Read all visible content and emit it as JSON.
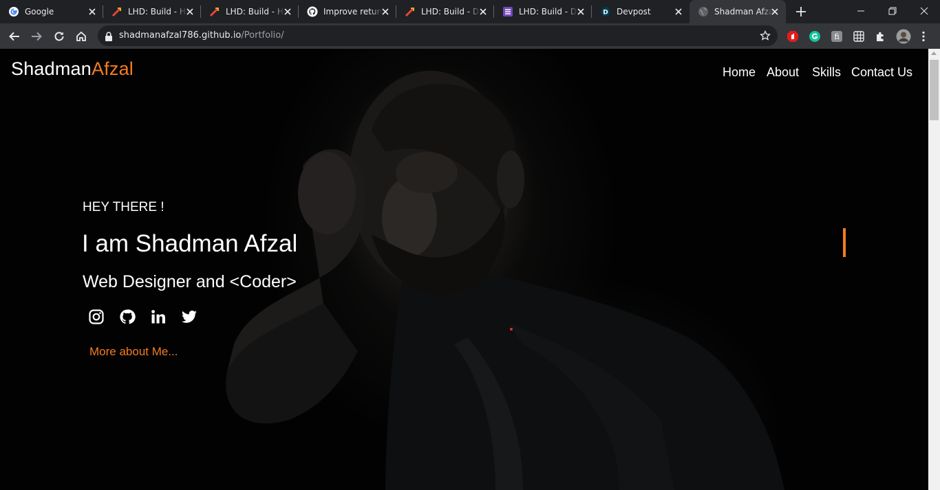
{
  "browser": {
    "tabs": [
      {
        "title": "Google",
        "icon": "google-icon",
        "active": false
      },
      {
        "title": "LHD: Build - Ho",
        "icon": "lhd-icon",
        "active": false
      },
      {
        "title": "LHD: Build - Ho",
        "icon": "lhd-icon",
        "active": false
      },
      {
        "title": "Improve return",
        "icon": "github-icon",
        "active": false
      },
      {
        "title": "LHD: Build - Da",
        "icon": "lhd-icon",
        "active": false
      },
      {
        "title": "LHD: Build - Da",
        "icon": "list-icon",
        "active": false
      },
      {
        "title": "Devpost",
        "icon": "devpost-icon",
        "active": false
      },
      {
        "title": "Shadman Afza",
        "icon": "globe-icon",
        "active": true
      }
    ],
    "url_host": "shadmanafzal786.github.io",
    "url_path": "/Portfolio/"
  },
  "site": {
    "logo_first": "Shadman",
    "logo_second": "Afzal",
    "nav": [
      "Home",
      "About",
      "Skills",
      "Contact Us"
    ],
    "greeting": "HEY THERE !",
    "headline": "I am Shadman Afzal",
    "subtitle": "Web Designer and <Coder>",
    "social": [
      "instagram-icon",
      "github-icon",
      "linkedin-icon",
      "twitter-icon"
    ],
    "more_link": "More about Me...",
    "accent_color": "#f47c20"
  }
}
